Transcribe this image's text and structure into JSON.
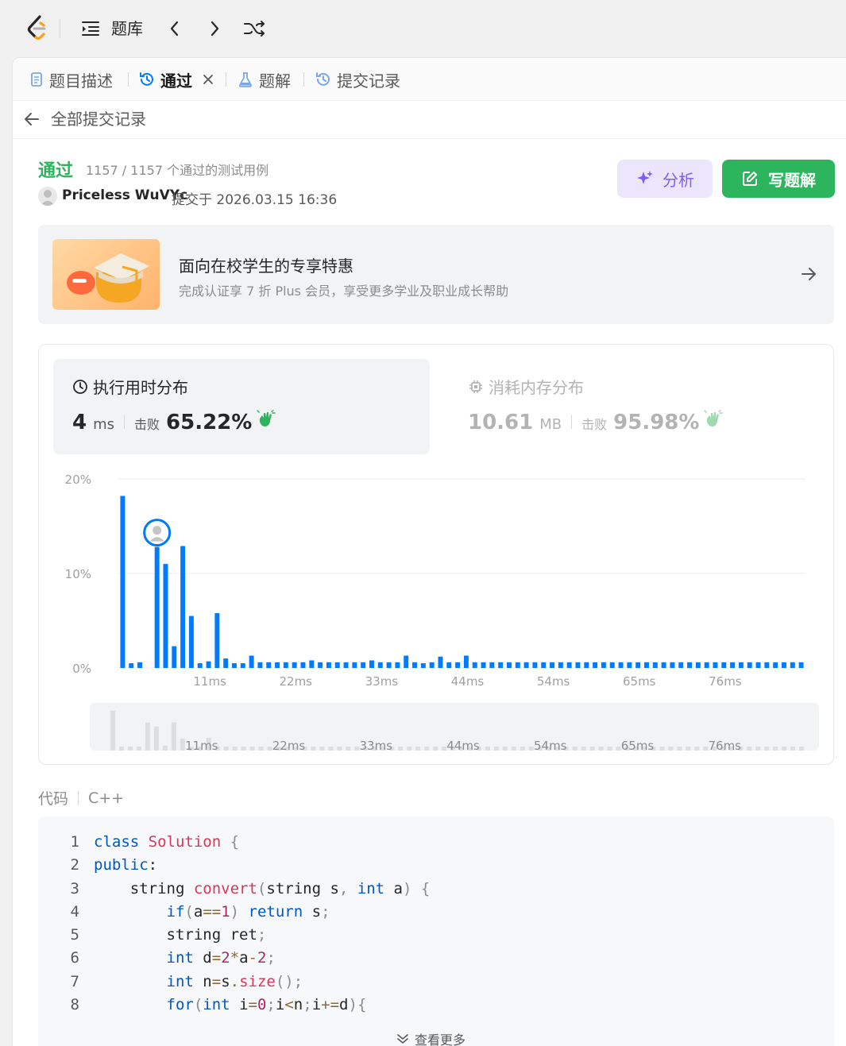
{
  "nav": {
    "title": "题库"
  },
  "tabs": [
    {
      "label": "题目描述"
    },
    {
      "label": "通过"
    },
    {
      "label": "题解"
    },
    {
      "label": "提交记录"
    }
  ],
  "back": {
    "label": "全部提交记录"
  },
  "submission": {
    "status": "通过",
    "cases": "1157 / 1157 个通过的测试用例",
    "user": "Priceless WuVYc",
    "submitted_at": "提交于 2026.03.15 16:36"
  },
  "actions": {
    "analyze": "分析",
    "write_solution": "写题解"
  },
  "promo": {
    "title": "面向在校学生的专享特惠",
    "subtitle": "完成认证享 7 折 Plus 会员，享受更多学业及职业成长帮助"
  },
  "runtime": {
    "title": "执行用时分布",
    "value": "4",
    "unit": "ms",
    "beat_label": "击败",
    "beat_pct": "65.22%"
  },
  "memory": {
    "title": "消耗内存分布",
    "value": "10.61",
    "unit": "MB",
    "beat_label": "击败",
    "beat_pct": "95.98%"
  },
  "chart_data": {
    "type": "bar",
    "y_ticks": [
      "20%",
      "10%",
      "0%"
    ],
    "ylim": [
      0,
      20
    ],
    "x_ticks": [
      "11ms",
      "22ms",
      "33ms",
      "44ms",
      "54ms",
      "65ms",
      "76ms"
    ],
    "values": [
      18.2,
      0.5,
      0.6,
      0,
      12.8,
      11.0,
      2.3,
      12.9,
      5.5,
      0.5,
      0.7,
      5.8,
      1.0,
      0.5,
      0.5,
      1.3,
      0.6,
      0.6,
      0.6,
      0.6,
      0.6,
      0.6,
      0.8,
      0.6,
      0.6,
      0.6,
      0.6,
      0.6,
      0.6,
      0.8,
      0.6,
      0.6,
      0.6,
      1.3,
      0.6,
      0.5,
      0.6,
      1.2,
      0.6,
      0.6,
      1.3,
      0.6,
      0.6,
      0.6,
      0.6,
      0.6,
      0.6,
      0.6,
      0.6,
      0.6,
      0.6,
      0.6,
      0.6,
      0.6,
      0.6,
      0.6,
      0.6,
      0.6,
      0.6,
      0.6,
      0.6,
      0.6,
      0.6,
      0.6,
      0.6,
      0.6,
      0.6,
      0.6,
      0.6,
      0.6,
      0.6,
      0.6,
      0.6,
      0.6,
      0.6,
      0.6,
      0.6,
      0.6,
      0.6,
      0.6
    ],
    "highlight_index": 4,
    "color": "#007aff"
  },
  "code": {
    "label": "代码",
    "language": "C++",
    "lines": [
      [
        [
          "kw",
          "class "
        ],
        [
          "cls",
          "Solution "
        ],
        [
          "pun",
          "{"
        ]
      ],
      [
        [
          "kw",
          "public"
        ],
        [
          "txt",
          ":"
        ]
      ],
      [
        [
          "txt",
          "    string "
        ],
        [
          "fn",
          "convert"
        ],
        [
          "pun",
          "("
        ],
        [
          "txt",
          "string s"
        ],
        [
          "pun",
          ", "
        ],
        [
          "kw",
          "int"
        ],
        [
          "txt",
          " a"
        ],
        [
          "pun",
          ") {"
        ]
      ],
      [
        [
          "txt",
          "        "
        ],
        [
          "kw",
          "if"
        ],
        [
          "pun",
          "("
        ],
        [
          "txt",
          "a"
        ],
        [
          "op",
          "=="
        ],
        [
          "num",
          "1"
        ],
        [
          "pun",
          ") "
        ],
        [
          "kw",
          "return"
        ],
        [
          "txt",
          " s"
        ],
        [
          "pun",
          ";"
        ]
      ],
      [
        [
          "txt",
          "        string ret"
        ],
        [
          "pun",
          ";"
        ]
      ],
      [
        [
          "txt",
          "        "
        ],
        [
          "kw",
          "int"
        ],
        [
          "txt",
          " d"
        ],
        [
          "op",
          "="
        ],
        [
          "num",
          "2"
        ],
        [
          "op",
          "*"
        ],
        [
          "txt",
          "a"
        ],
        [
          "op",
          "-"
        ],
        [
          "num",
          "2"
        ],
        [
          "pun",
          ";"
        ]
      ],
      [
        [
          "txt",
          "        "
        ],
        [
          "kw",
          "int"
        ],
        [
          "txt",
          " n"
        ],
        [
          "op",
          "="
        ],
        [
          "txt",
          "s"
        ],
        [
          "op",
          "."
        ],
        [
          "fn",
          "size"
        ],
        [
          "pun",
          "();"
        ]
      ],
      [
        [
          "txt",
          "        "
        ],
        [
          "kw",
          "for"
        ],
        [
          "pun",
          "("
        ],
        [
          "kw",
          "int"
        ],
        [
          "txt",
          " i"
        ],
        [
          "op",
          "="
        ],
        [
          "num",
          "0"
        ],
        [
          "pun",
          ";"
        ],
        [
          "txt",
          "i"
        ],
        [
          "op",
          "<"
        ],
        [
          "txt",
          "n"
        ],
        [
          "pun",
          ";"
        ],
        [
          "txt",
          "i"
        ],
        [
          "op",
          "+="
        ],
        [
          "txt",
          "d"
        ],
        [
          "pun",
          ")"
        ],
        [
          "pun",
          "{"
        ]
      ]
    ],
    "more": "查看更多"
  }
}
